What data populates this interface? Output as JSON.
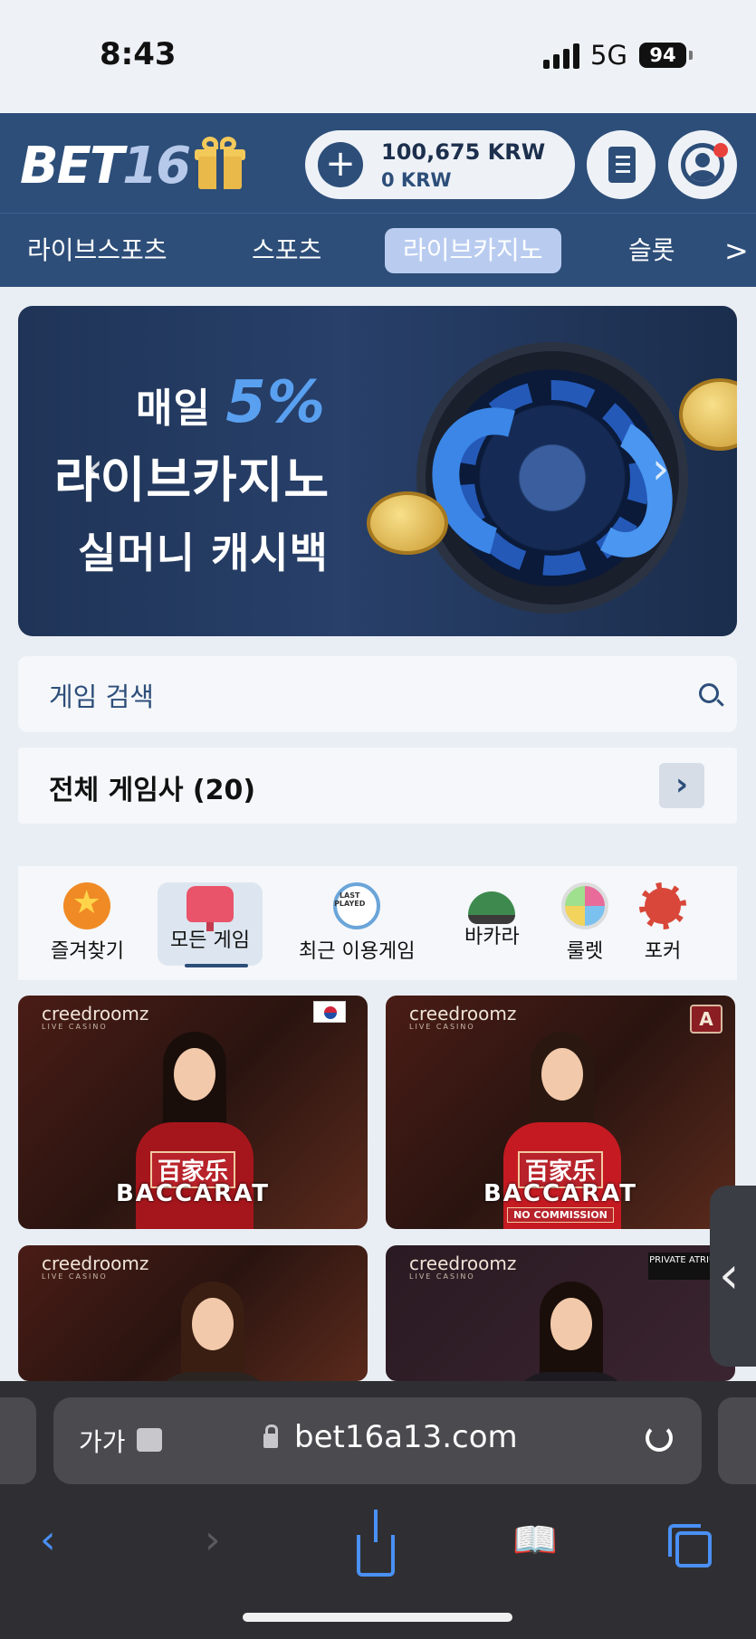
{
  "status": {
    "time": "8:43",
    "network": "5G",
    "battery": "94"
  },
  "header": {
    "logo_main": "BET",
    "logo_accent": "16",
    "balance_main": "100,675 KRW",
    "balance_sub": "0 KRW"
  },
  "nav": {
    "items": [
      {
        "label": "라이브스포츠"
      },
      {
        "label": "스포츠"
      },
      {
        "label": "라이브카지노"
      },
      {
        "label": "슬롯"
      }
    ],
    "more": ">"
  },
  "banner": {
    "line1_prefix": "매일 ",
    "line1_big": "5%",
    "line2": "라이브카지노",
    "line3": "실머니 캐시백"
  },
  "search": {
    "placeholder": "게임 검색"
  },
  "providers": {
    "title": "전체 게임사 (20)"
  },
  "categories": [
    {
      "label": "즐겨찾기",
      "icon": "star-icon"
    },
    {
      "label": "모든 게임",
      "icon": "lamp-icon"
    },
    {
      "label": "최근 이용게임",
      "icon": "recent-played-icon"
    },
    {
      "label": "바카라",
      "icon": "baccarat-table-icon"
    },
    {
      "label": "룰렛",
      "icon": "roulette-wheel-icon"
    },
    {
      "label": "포커",
      "icon": "poker-chip-icon"
    }
  ],
  "games": [
    {
      "brand": "creedroomz",
      "brand_sub": "LIVE CASINO",
      "title_zh": "百家乐",
      "title_en": "BACCARAT",
      "sub": ""
    },
    {
      "brand": "creedroomz",
      "brand_sub": "LIVE CASINO",
      "title_zh": "百家乐",
      "title_en": "BACCARAT",
      "sub": "NO COMMISSION",
      "badge": "A"
    },
    {
      "brand": "creedroomz",
      "brand_sub": "LIVE CASINO"
    },
    {
      "brand": "creedroomz",
      "brand_sub": "LIVE CASINO",
      "badge": "PRIVATE ATRIUM"
    }
  ],
  "browser": {
    "aa": "가가",
    "url": "bet16a13.com"
  },
  "colors": {
    "header": "#2d4e79",
    "nav_active": "#b9ccf0",
    "accent_blue": "#4a90f5"
  }
}
